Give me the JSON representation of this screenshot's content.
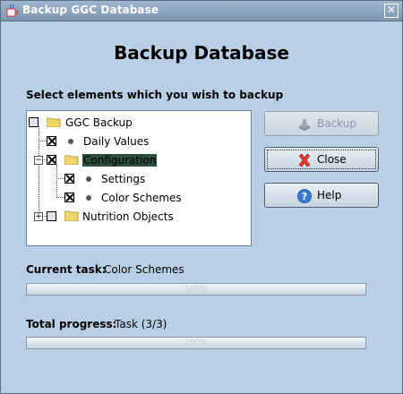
{
  "window": {
    "title": "Backup GGC Database",
    "close_symbol": "✕"
  },
  "heading": "Backup Database",
  "instruction": "Select elements which you wish to backup",
  "tree": {
    "root": {
      "label": "GGC Backup",
      "state": "partial"
    },
    "items": [
      {
        "label": "Daily Values",
        "checked": true
      },
      {
        "label": "Configuration",
        "checked": true,
        "selected": true,
        "expanded": true
      },
      {
        "label": "Settings",
        "checked": true
      },
      {
        "label": "Color Schemes",
        "checked": true
      },
      {
        "label": "Nutrition Objects",
        "checked": false,
        "collapsed": true
      }
    ],
    "expander_minus": "−",
    "expander_plus": "+"
  },
  "buttons": {
    "backup": {
      "label": "Backup",
      "enabled": false,
      "icon": "backup-icon"
    },
    "close": {
      "label": "Close",
      "enabled": true,
      "icon": "red-x-icon"
    },
    "help": {
      "label": "Help",
      "enabled": true,
      "icon": "help-icon"
    }
  },
  "current_task": {
    "label": "Current task:",
    "value": "Color Schemes",
    "progress_text": "100%",
    "progress": 1.0
  },
  "total_progress": {
    "label": "Total progress:",
    "value": "Task (3/3)",
    "progress_text": "100%",
    "progress": 1.0
  },
  "colors": {
    "accent": "#2c4f3c",
    "window_bg": "#b8cfe5",
    "title_bg": "#7d95b0"
  }
}
